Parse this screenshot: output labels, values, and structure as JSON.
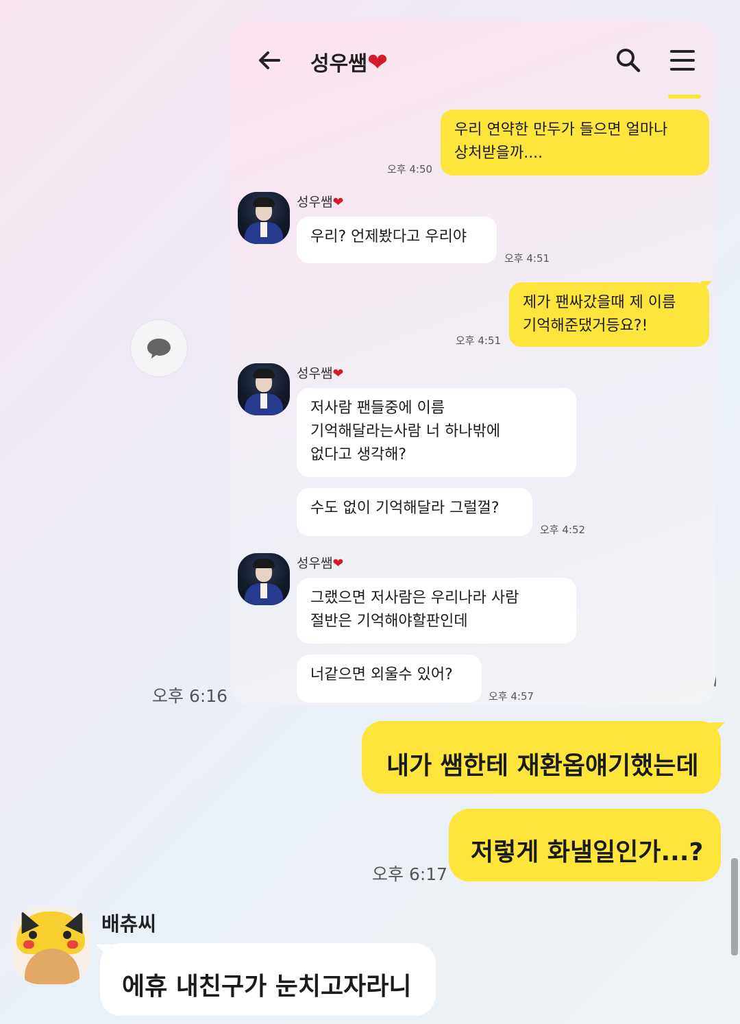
{
  "inner_chat": {
    "title": "성우쌤",
    "title_heart": "❤",
    "icons": [
      "back-arrow-icon",
      "search-icon",
      "menu-icon"
    ],
    "sender_name": "성우쌤",
    "sender_heart": "❤",
    "messages": [
      {
        "id": "m1",
        "side": "right",
        "text": "우리 연약한 만두가 들으면 얼마나\n상처받을까....",
        "time": "오후 4:50"
      },
      {
        "id": "m2",
        "side": "left",
        "text": "우리? 언제봤다고 우리야",
        "time": "오후 4:51"
      },
      {
        "id": "m3",
        "side": "right",
        "text": "제가 팬싸갔을때 제 이름\n기억해준댔거등요?!",
        "time": "오후 4:51"
      },
      {
        "id": "m4",
        "side": "left",
        "text": "저사람 팬들중에 이름\n기억해달라는사람 너 하나밖에\n없다고 생각해?",
        "time": ""
      },
      {
        "id": "m5",
        "side": "left",
        "text": "수도 없이 기억해달라 그럴껄?",
        "time": "오후 4:52"
      },
      {
        "id": "m6",
        "side": "left",
        "text": "그랬으면 저사람은 우리나라 사람\n절반은 기억해야할판인데",
        "time": ""
      },
      {
        "id": "m7",
        "side": "left",
        "text": "너같으면 외울수 있어?",
        "time": "오후 4:57"
      }
    ]
  },
  "outer_chat": {
    "image_time": "오후 6:16",
    "messages": [
      {
        "id": "o1",
        "side": "right",
        "text": "내가 쌤한테 재환옵얘기했는데",
        "time": ""
      },
      {
        "id": "o2",
        "side": "right",
        "text": "저렇게 화낼일인가...?",
        "time": "오후 6:17"
      },
      {
        "id": "o3",
        "side": "left",
        "sender": "배츄씨",
        "text": "에휴 내친구가 눈치고자라니",
        "time": ""
      }
    ]
  },
  "colors": {
    "bubble_yellow": "#fde53b",
    "bubble_white": "#ffffff",
    "heart_red": "#d51a2a"
  }
}
